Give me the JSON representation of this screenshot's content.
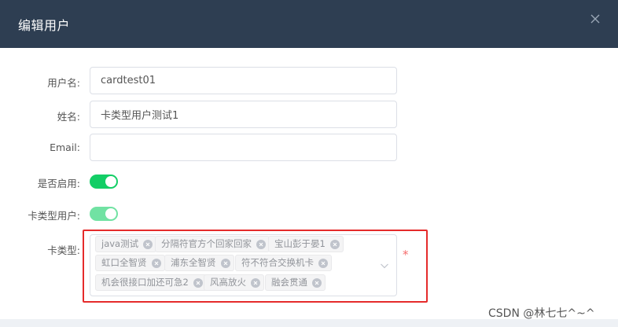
{
  "dialog": {
    "title": "编辑用户",
    "close_icon": "close-icon"
  },
  "form": {
    "username": {
      "label": "用户名:",
      "value": "cardtest01"
    },
    "name": {
      "label": "姓名:",
      "value": "卡类型用户测试1"
    },
    "email": {
      "label": "Email:",
      "value": ""
    },
    "enabled": {
      "label": "是否启用:",
      "on": true
    },
    "card_user": {
      "label": "卡类型用户:",
      "on": true,
      "disabled": true
    },
    "card_type": {
      "label": "卡类型:",
      "tags": [
        "java测试",
        "分隔符官方个回家回家",
        "宝山彭于晏1",
        "虹口全智贤",
        "浦东全智贤",
        "符不符合交换机卡",
        "机会很接口加还可急2",
        "风高放火",
        "融会贯通"
      ],
      "required_mark": "*"
    }
  },
  "colors": {
    "header_bg": "#2e3e52",
    "switch_on": "#13ce66",
    "highlight": "#e52b2b",
    "required": "#f56c6c"
  },
  "watermark": "CSDN @林七七^~^"
}
